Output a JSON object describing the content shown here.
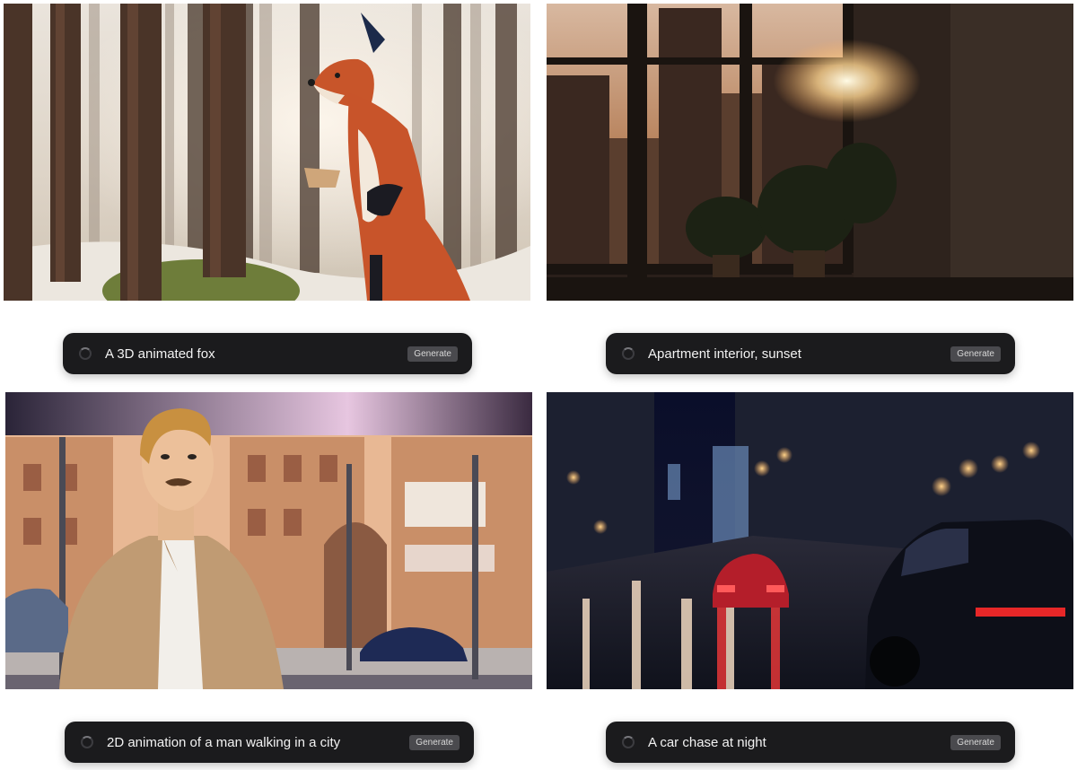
{
  "cards": [
    {
      "prompt": "A 3D animated fox",
      "button": "Generate",
      "image_icon": "fox-in-forest-image"
    },
    {
      "prompt": "Apartment interior, sunset",
      "button": "Generate",
      "image_icon": "apartment-sunset-image"
    },
    {
      "prompt": "2D animation of a man walking in a city",
      "button": "Generate",
      "image_icon": "man-in-city-image"
    },
    {
      "prompt": "A car chase at night",
      "button": "Generate",
      "image_icon": "night-car-chase-image"
    }
  ],
  "colors": {
    "bar_bg": "#1b1b1d",
    "button_bg": "#4a4a4e",
    "text": "#f2f2f2"
  }
}
